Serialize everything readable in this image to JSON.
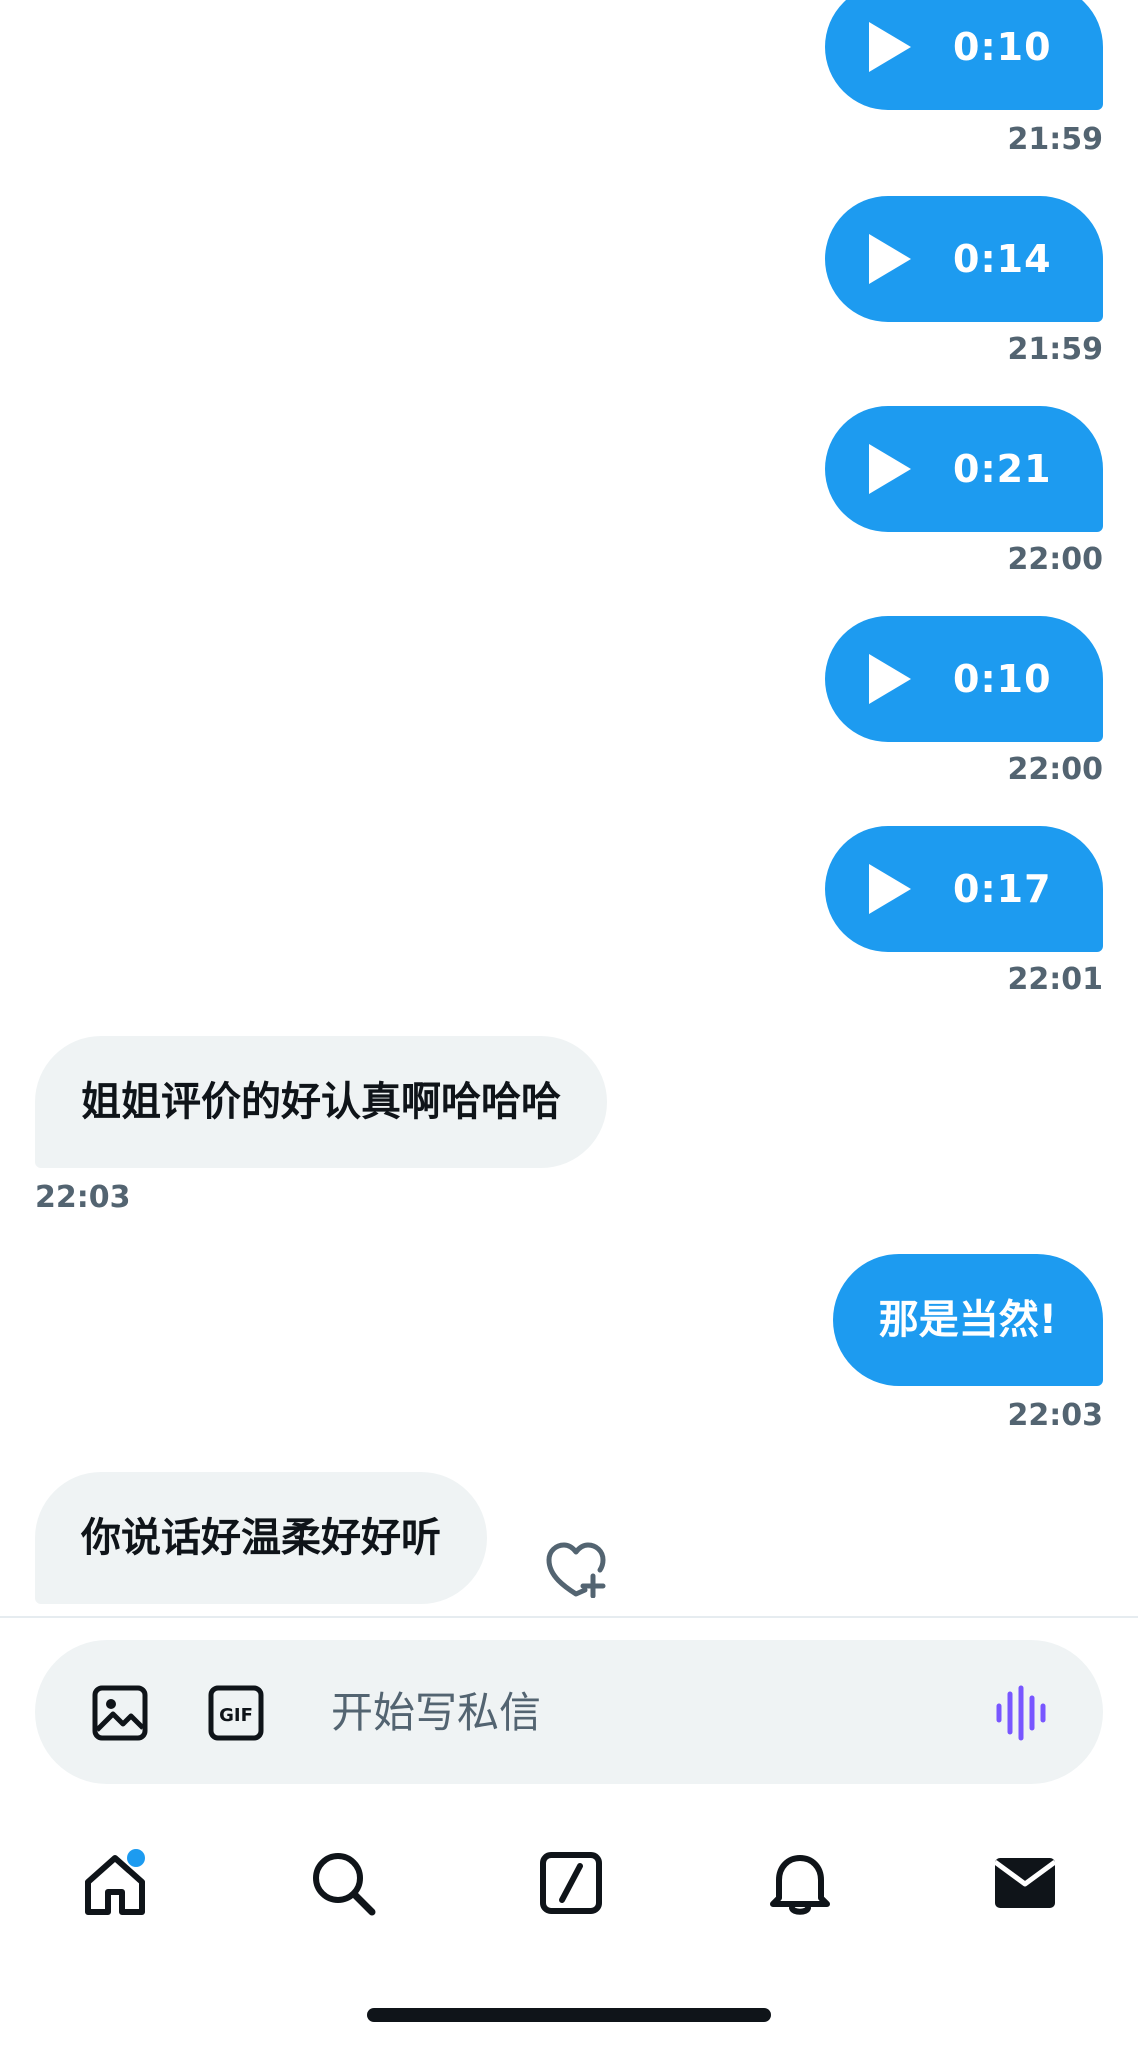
{
  "voice_messages": [
    {
      "duration": "0:10",
      "time": "21:59"
    },
    {
      "duration": "0:14",
      "time": "21:59"
    },
    {
      "duration": "0:21",
      "time": "22:00"
    },
    {
      "duration": "0:10",
      "time": "22:00"
    },
    {
      "duration": "0:17",
      "time": "22:01"
    }
  ],
  "text_messages": [
    {
      "direction": "incoming",
      "text": "姐姐评价的好认真啊哈哈哈",
      "time": "22:03"
    },
    {
      "direction": "outgoing",
      "text": "那是当然!",
      "time": "22:03"
    },
    {
      "direction": "incoming",
      "text": "你说话好温柔好好听",
      "time": ""
    }
  ],
  "composer": {
    "placeholder": "开始写私信",
    "icons": [
      "image-icon",
      "gif-icon",
      "voice-waveform-icon"
    ]
  },
  "tabbar": {
    "items": [
      "home-icon",
      "search-icon",
      "compose-icon",
      "bell-icon",
      "mail-icon"
    ],
    "active": "mail-icon",
    "home_badge": true
  },
  "colors": {
    "accent": "#1d9bf0",
    "incoming_bubble": "#eff3f4",
    "timestamp": "#536471",
    "voice_icon": "#7856ff"
  }
}
